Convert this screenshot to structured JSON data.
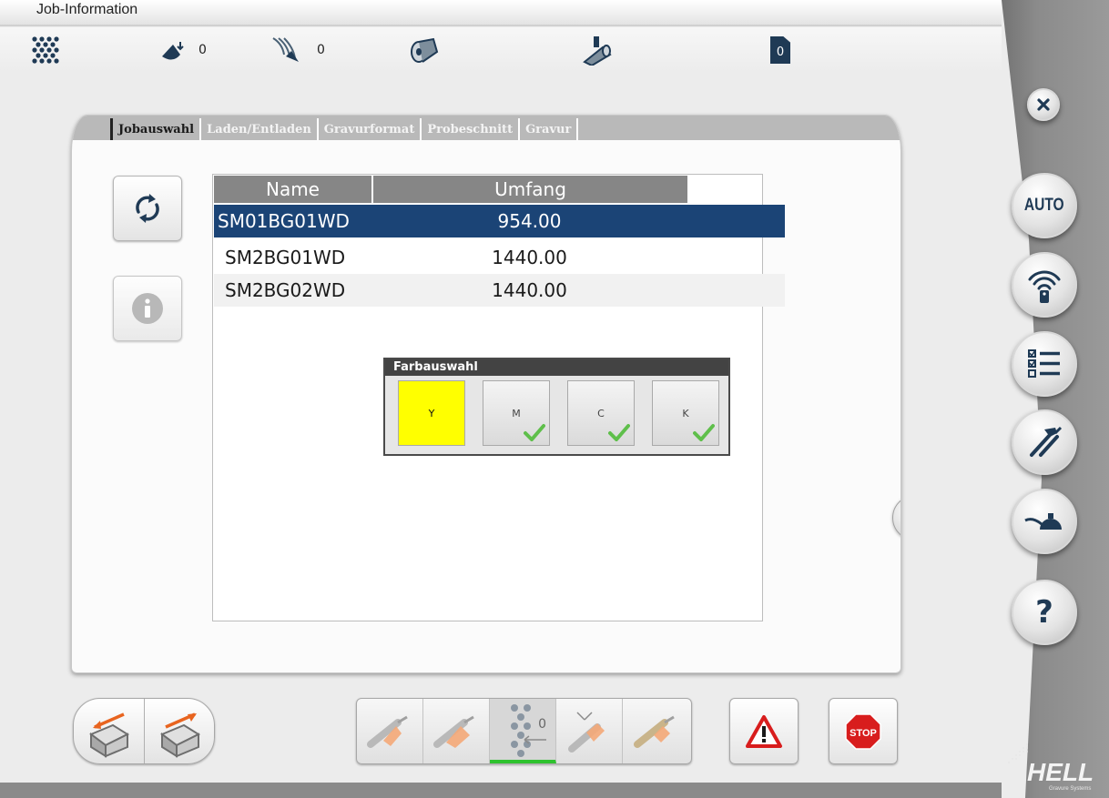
{
  "window": {
    "title": "Job-Information"
  },
  "status_bar": {
    "items": [
      {
        "icon": "screen-pattern-icon"
      },
      {
        "icon": "ink-drop-icon",
        "value": "0"
      },
      {
        "icon": "stylus-cut-icon",
        "value": "0"
      },
      {
        "icon": "cylinder-icon"
      },
      {
        "icon": "engraving-head-icon"
      },
      {
        "icon": "document-counter-icon",
        "value": "0"
      }
    ]
  },
  "tabs": [
    {
      "label": "Jobauswahl",
      "active": true
    },
    {
      "label": "Laden/Entladen",
      "active": false
    },
    {
      "label": "Gravurformat",
      "active": false
    },
    {
      "label": "Probeschnitt",
      "active": false
    },
    {
      "label": "Gravur",
      "active": false
    }
  ],
  "side_buttons": [
    {
      "icon": "refresh-icon"
    },
    {
      "icon": "info-icon"
    }
  ],
  "job_table": {
    "columns": [
      "Name",
      "Umfang"
    ],
    "rows": [
      {
        "name": "SM01BG01WD",
        "umfang": "954.00",
        "selected": true
      },
      {
        "name": "SM2BG01WD",
        "umfang": "1440.00",
        "selected": false
      },
      {
        "name": "SM2BG02WD",
        "umfang": "1440.00",
        "selected": false
      }
    ]
  },
  "color_picker": {
    "title": "Farbauswahl",
    "options": [
      {
        "label": "Y",
        "selected": true,
        "done": false,
        "color": "#ffff00"
      },
      {
        "label": "M",
        "selected": false,
        "done": true
      },
      {
        "label": "C",
        "selected": false,
        "done": true
      },
      {
        "label": "K",
        "selected": false,
        "done": true
      }
    ]
  },
  "right_sidebar": {
    "close_icon": "close-icon",
    "auto_label": "AUTO",
    "help_label": "?",
    "icons": [
      "remote-control-icon",
      "checklist-icon",
      "tools-icon",
      "oil-can-icon"
    ]
  },
  "bottom_toolbar": {
    "process_counter": "0",
    "stop_label": "STOP"
  },
  "brand": {
    "name": "HELL",
    "tagline": "Gravure Systems"
  },
  "colors": {
    "accent": "#1b4476",
    "header_gray": "#868686",
    "tab_gray": "#b9b9b9",
    "selection_yellow": "#ffff00",
    "check_green": "#5fbf4b",
    "warning_red": "#d81d1d"
  }
}
